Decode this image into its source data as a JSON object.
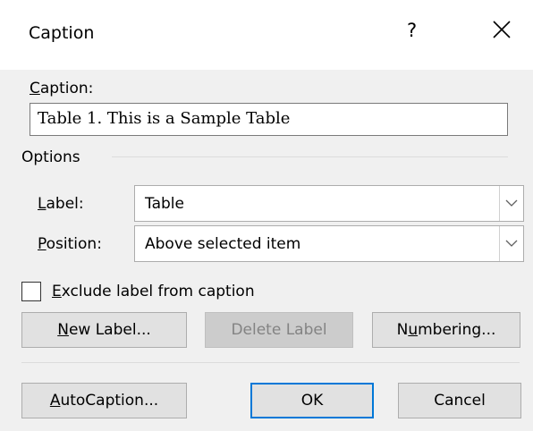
{
  "dialog": {
    "title": "Caption",
    "help_glyph": "?",
    "close_icon": "close-icon"
  },
  "caption": {
    "label_hotkey": "C",
    "label_rest": "aption:",
    "value": "Table 1. This is a Sample Table"
  },
  "options": {
    "group_label": "Options",
    "label_field": {
      "hotkey": "L",
      "rest": "abel:",
      "value": "Table"
    },
    "position_field": {
      "hotkey": "P",
      "rest": "osition:",
      "value": "Above selected item"
    }
  },
  "exclude_checkbox": {
    "checked": false,
    "hotkey": "E",
    "rest": "xclude label from caption"
  },
  "buttons": {
    "new_label": {
      "hotkey": "N",
      "rest": "ew Label..."
    },
    "delete_label": "Delete Label",
    "numbering": {
      "pre": "N",
      "hotkey": "u",
      "rest": "mbering..."
    },
    "autocaption": {
      "hotkey": "A",
      "rest": "utoCaption..."
    },
    "ok": "OK",
    "cancel": "Cancel"
  },
  "colors": {
    "accent": "#0078d7",
    "dialog_background": "#f0f0f0"
  }
}
